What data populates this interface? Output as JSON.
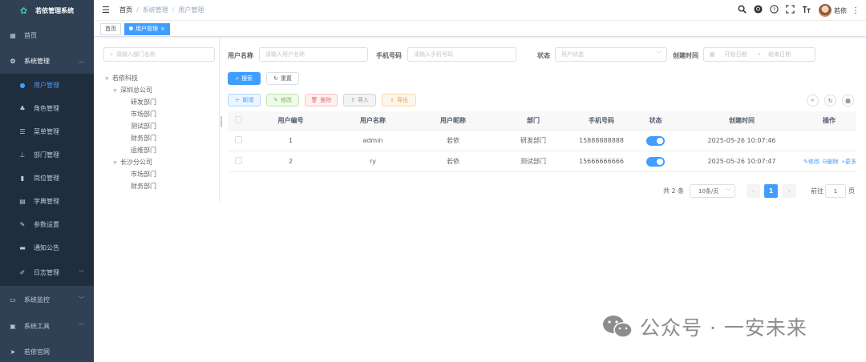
{
  "app": {
    "title": "若依管理系统"
  },
  "sidebar": {
    "items": [
      {
        "label": "首页",
        "icon": "dashboard-icon"
      },
      {
        "label": "系统管理",
        "icon": "gear-icon",
        "arrow": "^"
      },
      {
        "label": "用户管理",
        "icon": "user-icon"
      },
      {
        "label": "角色管理",
        "icon": "users-icon"
      },
      {
        "label": "菜单管理",
        "icon": "list-icon"
      },
      {
        "label": "部门管理",
        "icon": "tree-icon"
      },
      {
        "label": "岗位管理",
        "icon": "post-icon"
      },
      {
        "label": "字典管理",
        "icon": "dict-icon"
      },
      {
        "label": "参数设置",
        "icon": "edit-icon"
      },
      {
        "label": "通知公告",
        "icon": "message-icon"
      },
      {
        "label": "日志管理",
        "icon": "log-icon",
        "arrow": "v"
      },
      {
        "label": "系统监控",
        "icon": "monitor-icon",
        "arrow": "v"
      },
      {
        "label": "系统工具",
        "icon": "tool-icon",
        "arrow": "v"
      },
      {
        "label": "若依官网",
        "icon": "send-icon"
      }
    ]
  },
  "breadcrumb": [
    "首页",
    "系统管理",
    "用户管理"
  ],
  "navbar": {
    "user": "若依"
  },
  "tags": [
    {
      "label": "首页"
    },
    {
      "label": "用户管理"
    }
  ],
  "tree": {
    "search_placeholder": "请输入部门名称",
    "nodes": [
      {
        "label": "若依科技",
        "caret": "v"
      },
      {
        "label": "深圳总公司",
        "caret": "v"
      },
      {
        "label": "研发部门",
        "caret": ""
      },
      {
        "label": "市场部门",
        "caret": ""
      },
      {
        "label": "测试部门",
        "caret": ""
      },
      {
        "label": "财务部门",
        "caret": ""
      },
      {
        "label": "运维部门",
        "caret": ""
      },
      {
        "label": "长沙分公司",
        "caret": "v"
      },
      {
        "label": "市场部门",
        "caret": ""
      },
      {
        "label": "财务部门",
        "caret": ""
      }
    ]
  },
  "search": {
    "username_label": "用户名称",
    "username_placeholder": "请输入用户名称",
    "phone_label": "手机号码",
    "phone_placeholder": "请输入手机号码",
    "status_label": "状态",
    "status_placeholder": "用户状态",
    "time_label": "创建时间",
    "start_placeholder": "开始日期",
    "end_placeholder": "结束日期",
    "range_sep": "-",
    "search_btn": "搜索",
    "reset_btn": "重置"
  },
  "toolbar": {
    "add": "新增",
    "edit": "修改",
    "delete": "删除",
    "import": "导入",
    "export": "导出"
  },
  "table": {
    "columns": [
      "用户编号",
      "用户名称",
      "用户昵称",
      "部门",
      "手机号码",
      "状态",
      "创建时间",
      "操作"
    ],
    "rows": [
      {
        "id": "1",
        "username": "admin",
        "nickname": "若依",
        "dept": "研发部门",
        "phone": "15888888888",
        "created": "2025-05-26 10:07:46",
        "status": "on"
      },
      {
        "id": "2",
        "username": "ry",
        "nickname": "若依",
        "dept": "测试部门",
        "phone": "15666666666",
        "created": "2025-05-26 10:07:47",
        "status": "on",
        "ops": {
          "edit": "修改",
          "delete": "删除",
          "more": "更多"
        }
      }
    ]
  },
  "pagination": {
    "total": "共 2 条",
    "page_size": "10条/页",
    "current": "1",
    "goto_label": "前往",
    "goto_value": "1",
    "page_unit": "页"
  },
  "watermark": {
    "text": "公众号 · 一安未来"
  },
  "colors": {
    "sidebar_bg": "#304156",
    "primary": "#409eff"
  }
}
